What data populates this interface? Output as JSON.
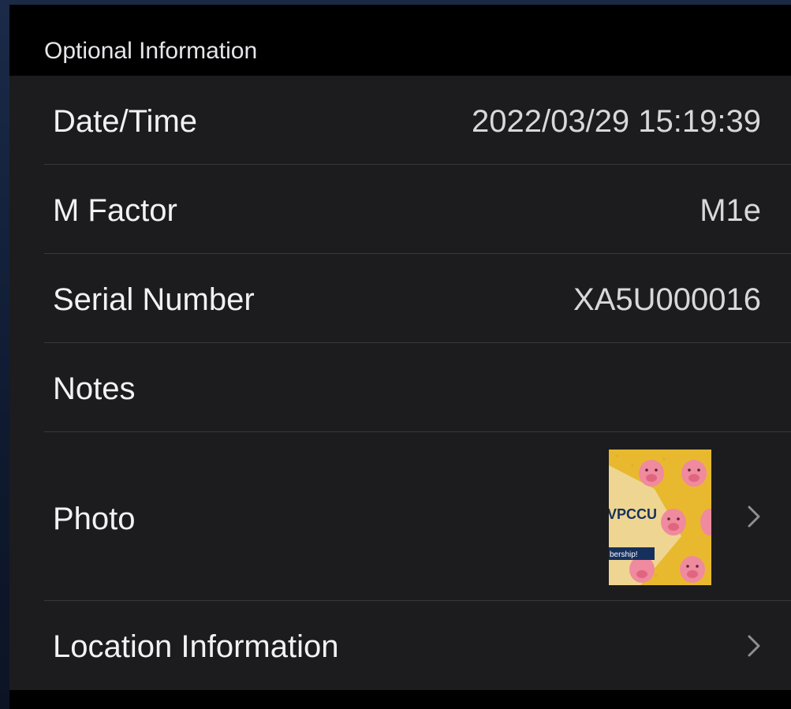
{
  "section": {
    "title": "Optional Information"
  },
  "rows": {
    "datetime": {
      "label": "Date/Time",
      "value": "2022/03/29 15:19:39"
    },
    "mfactor": {
      "label": "M Factor",
      "value": "M1e"
    },
    "serial": {
      "label": "Serial Number",
      "value": "XA5U000016"
    },
    "notes": {
      "label": "Notes",
      "value": ""
    },
    "photo": {
      "label": "Photo",
      "thumbnail_text_1": "VPCCU",
      "thumbnail_text_2": "bership!"
    },
    "location": {
      "label": "Location Information"
    }
  },
  "icons": {
    "chevron": "chevron-right-icon"
  },
  "colors": {
    "background": "#000000",
    "group": "#1c1c1e",
    "label": "#f2f2f5",
    "value": "#d7d7dc",
    "divider": "#38383c",
    "chevron": "#8e8e93",
    "thumbnail_yellow": "#e8b92e",
    "thumbnail_pig": "#f08a9e"
  }
}
